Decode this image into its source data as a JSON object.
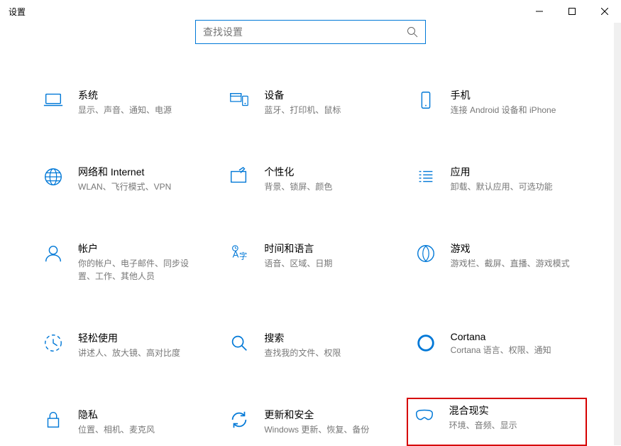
{
  "window": {
    "title": "设置"
  },
  "search": {
    "placeholder": "查找设置"
  },
  "tiles": [
    {
      "title": "系统",
      "desc": "显示、声音、通知、电源"
    },
    {
      "title": "设备",
      "desc": "蓝牙、打印机、鼠标"
    },
    {
      "title": "手机",
      "desc": "连接 Android 设备和 iPhone"
    },
    {
      "title": "网络和 Internet",
      "desc": "WLAN、飞行模式、VPN"
    },
    {
      "title": "个性化",
      "desc": "背景、锁屏、颜色"
    },
    {
      "title": "应用",
      "desc": "卸载、默认应用、可选功能"
    },
    {
      "title": "帐户",
      "desc": "你的帐户、电子邮件、同步设置、工作、其他人员"
    },
    {
      "title": "时间和语言",
      "desc": "语音、区域、日期"
    },
    {
      "title": "游戏",
      "desc": "游戏栏、截屏、直播、游戏模式"
    },
    {
      "title": "轻松使用",
      "desc": "讲述人、放大镜、高对比度"
    },
    {
      "title": "搜索",
      "desc": "查找我的文件、权限"
    },
    {
      "title": "Cortana",
      "desc": "Cortana 语言、权限、通知"
    },
    {
      "title": "隐私",
      "desc": "位置、相机、麦克风"
    },
    {
      "title": "更新和安全",
      "desc": "Windows 更新、恢复、备份"
    },
    {
      "title": "混合现实",
      "desc": "环境、音频、显示"
    }
  ]
}
